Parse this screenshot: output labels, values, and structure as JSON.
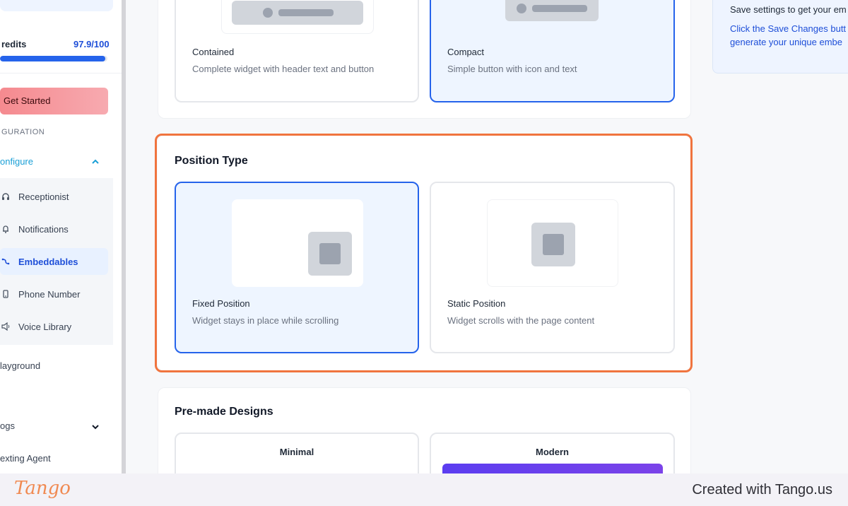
{
  "sidebar": {
    "credits_label": "redits",
    "credits_value": "97.9/100",
    "credits_fraction": 0.979,
    "get_started": "Get Started",
    "section_label": "GURATION",
    "configure_label": "onfigure",
    "items": [
      {
        "label": "Receptionist",
        "icon": "headset-icon"
      },
      {
        "label": "Notifications",
        "icon": "bell-icon"
      },
      {
        "label": "Embeddables",
        "icon": "embed-icon",
        "active": true
      },
      {
        "label": "Phone Number",
        "icon": "phone-icon"
      },
      {
        "label": "Voice Library",
        "icon": "speaker-icon"
      }
    ],
    "playground": "layground",
    "logs": "ogs",
    "texting_agent": "exting Agent"
  },
  "widget_style": {
    "contained_title": "Contained",
    "contained_desc": "Complete widget with header text and button",
    "compact_title": "Compact",
    "compact_desc": "Simple button with icon and text"
  },
  "position_type": {
    "title": "Position Type",
    "fixed_title": "Fixed Position",
    "fixed_desc": "Widget stays in place while scrolling",
    "static_title": "Static Position",
    "static_desc": "Widget scrolls with the page content"
  },
  "premade": {
    "title": "Pre-made Designs",
    "minimal": "Minimal",
    "modern": "Modern"
  },
  "info": {
    "title": "Save settings to get your em",
    "line1": "Click the Save Changes butt",
    "line2": "generate your unique embe"
  },
  "footer": {
    "logo": "Tango",
    "credit": "Created with Tango.us"
  },
  "colors": {
    "accent": "#2563eb",
    "highlight": "#f0743e",
    "selected_bg": "#eef5ff"
  }
}
